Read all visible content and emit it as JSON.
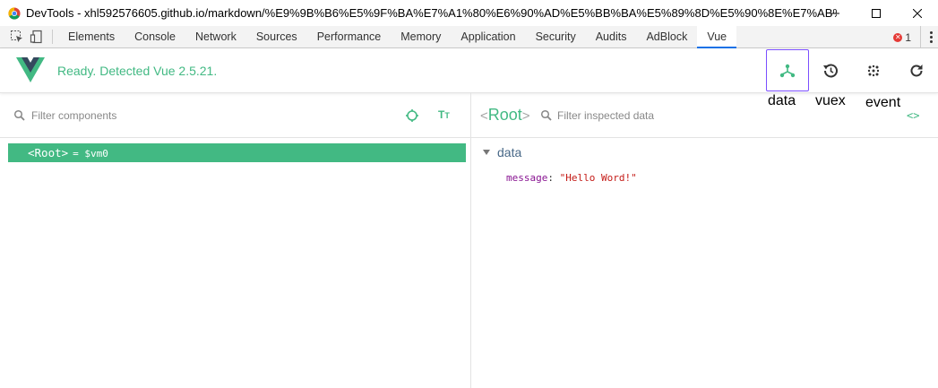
{
  "window": {
    "title": "DevTools - xhl592576605.github.io/markdown/%E9%9B%B6%E5%9F%BA%E7%A1%80%E6%90%AD%E5%BB%BA%E5%89%8D%E5%90%8E%E7%AB%A..."
  },
  "devtools_tabs": [
    "Elements",
    "Console",
    "Network",
    "Sources",
    "Performance",
    "Memory",
    "Application",
    "Security",
    "Audits",
    "AdBlock",
    "Vue"
  ],
  "active_tab": "Vue",
  "error_count": "1",
  "vue": {
    "status": "Ready. Detected Vue 2.5.21.",
    "brand_color": "#42b983",
    "actions": [
      {
        "icon": "components-icon",
        "label": "data"
      },
      {
        "icon": "history-icon",
        "label": "vuex"
      },
      {
        "icon": "events-icon",
        "label": "event"
      },
      {
        "icon": "refresh-icon",
        "label": ""
      }
    ]
  },
  "left": {
    "filter_placeholder": "Filter components",
    "tree": {
      "tag": "Root",
      "vm": "= $vm0"
    }
  },
  "right": {
    "selected_name": "Root",
    "filter_placeholder": "Filter inspected data",
    "section": "data",
    "fields": [
      {
        "key": "message",
        "value": "\"Hello Word!\""
      }
    ]
  }
}
